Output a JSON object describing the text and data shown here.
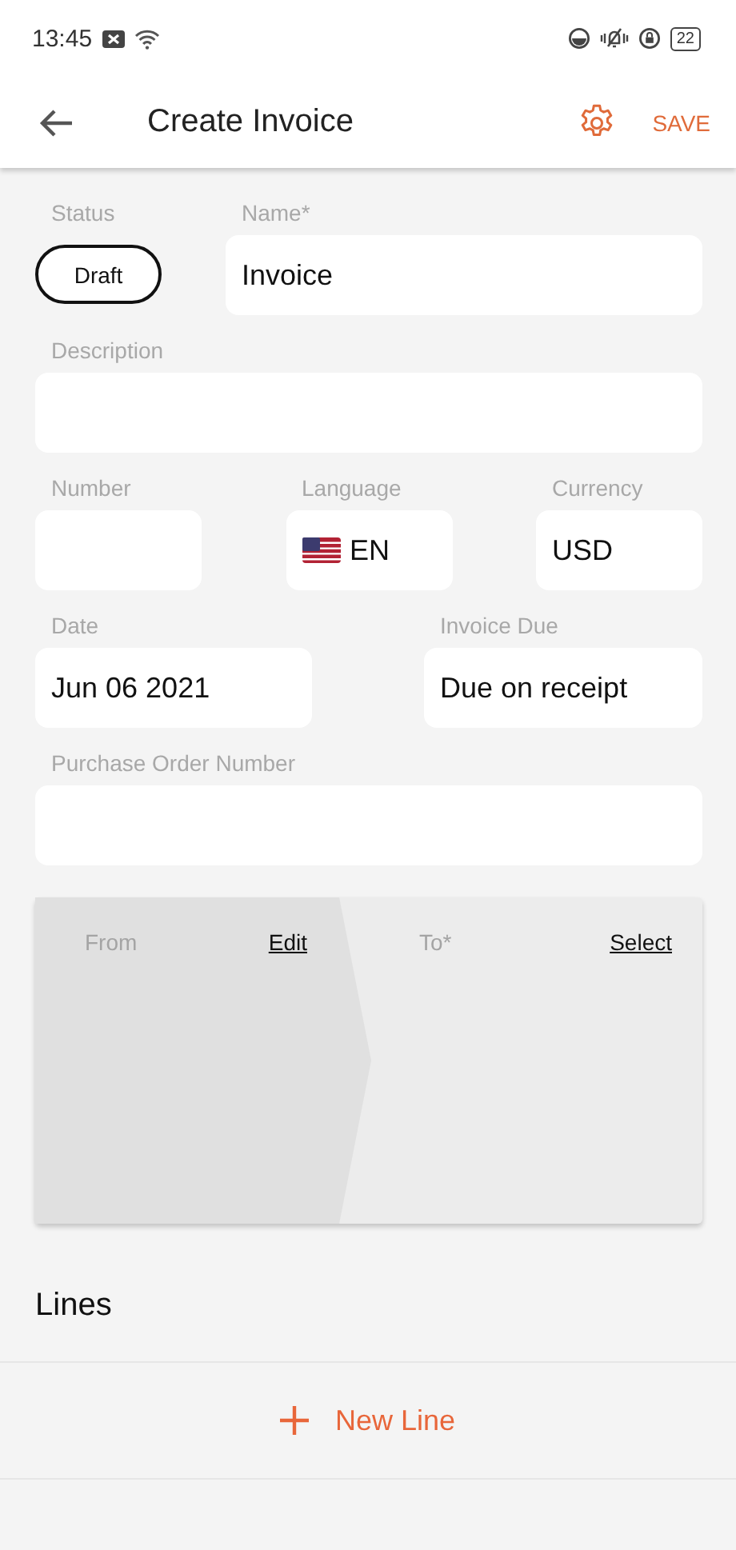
{
  "status_bar": {
    "time": "13:45",
    "battery": "22"
  },
  "app_bar": {
    "title": "Create Invoice",
    "action": "SAVE"
  },
  "form": {
    "status": {
      "label": "Status",
      "value": "Draft"
    },
    "name": {
      "label": "Name*",
      "value": "Invoice"
    },
    "description": {
      "label": "Description"
    },
    "number": {
      "label": "Number"
    },
    "language": {
      "label": "Language",
      "value": "EN"
    },
    "currency": {
      "label": "Currency",
      "value": "USD"
    },
    "date": {
      "label": "Date",
      "value": "Jun 06 2021"
    },
    "invoice_due": {
      "label": "Invoice Due",
      "value": "Due on receipt"
    },
    "purchase_order": {
      "label": "Purchase Order Number"
    }
  },
  "parties": {
    "from": {
      "label": "From",
      "link": "Edit"
    },
    "to": {
      "label": "To*",
      "link": "Select"
    }
  },
  "lines": {
    "title": "Lines",
    "new_line": "New Line"
  }
}
